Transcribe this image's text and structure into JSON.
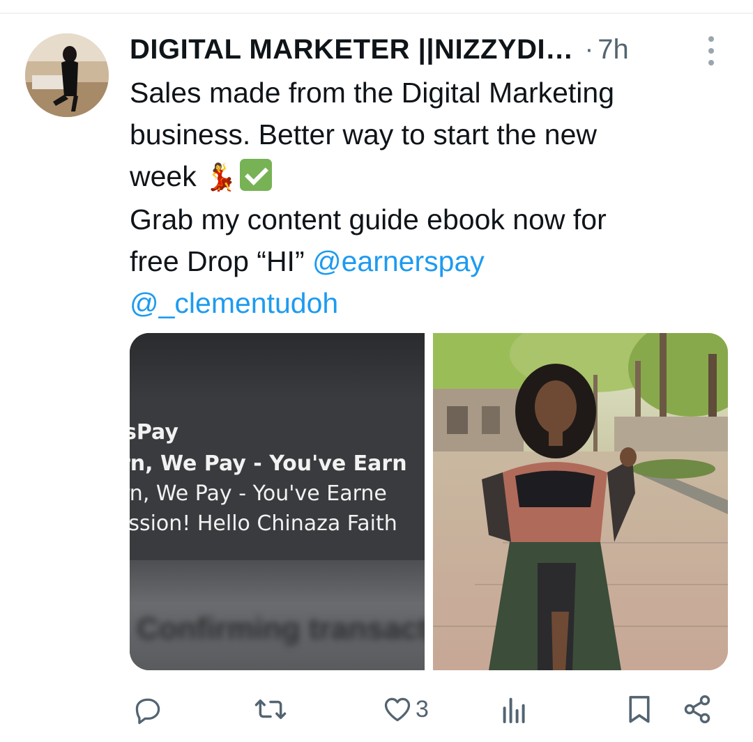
{
  "tweet": {
    "author": {
      "display_name": "DIGITAL MARKETER ||NIZZYDI…",
      "separator": "·",
      "time": "7h"
    },
    "text": {
      "line1": "Sales made from the Digital Marketing",
      "line2": "business. Better way to start the new",
      "line3_text": "week ",
      "line3_emoji": "💃",
      "line4": "Grab my content guide ebook now for",
      "line5_text": "free Drop “HI” ",
      "mention1": "@earnerspay",
      "mention2": "@_clementudoh"
    },
    "media": {
      "screenshot": {
        "app_name": "sPay",
        "title": "rn, We Pay - You've Earn",
        "body1": "rn, We Pay - You've Earne",
        "body2": "ission! Hello Chinaza Faith"
      }
    },
    "actions": {
      "reply_icon": "reply-icon",
      "retweet_icon": "retweet-icon",
      "like_icon": "heart-icon",
      "like_count": "3",
      "views_icon": "views-icon",
      "bookmark_icon": "bookmark-icon",
      "share_icon": "share-icon"
    }
  },
  "colors": {
    "text": "#0f1419",
    "secondary": "#536471",
    "link": "#1d9bf0",
    "divider": "#eff3f4"
  }
}
